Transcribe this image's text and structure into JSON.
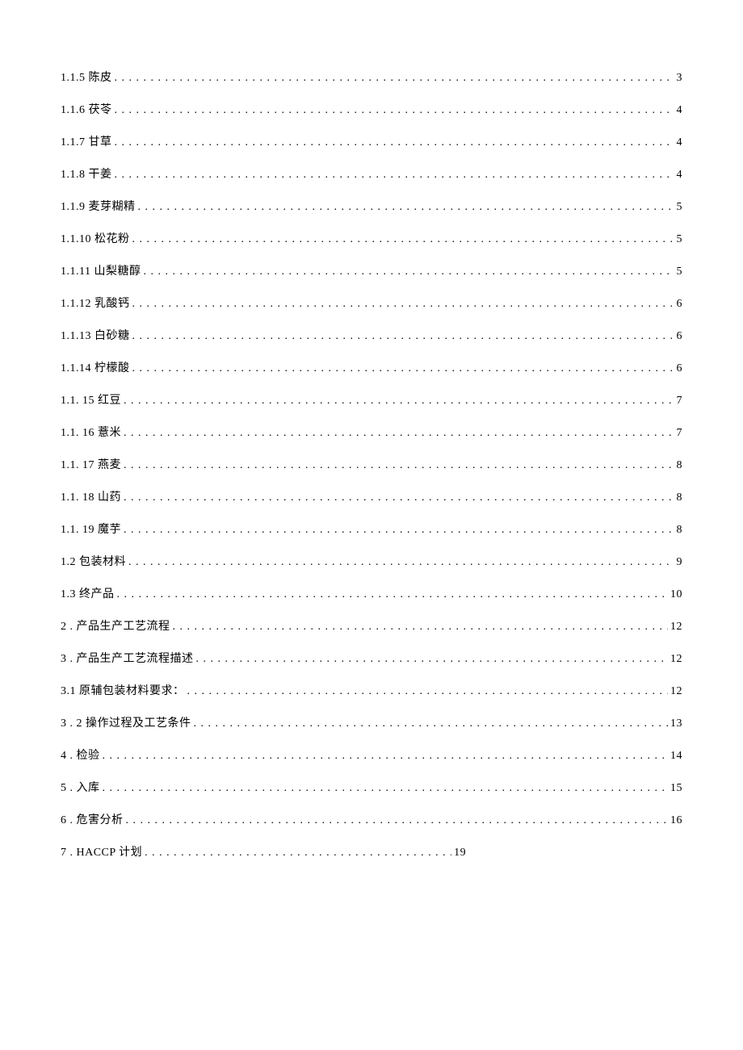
{
  "toc": [
    {
      "label": "1.1.5 陈皮 ",
      "page": "3",
      "short": false
    },
    {
      "label": "1.1.6 茯苓 ",
      "page": "4",
      "short": false
    },
    {
      "label": "1.1.7 甘草 ",
      "page": "4",
      "short": false
    },
    {
      "label": "1.1.8 干姜 ",
      "page": "4",
      "short": false
    },
    {
      "label": "1.1.9 麦芽糊精 ",
      "page": "5",
      "short": false
    },
    {
      "label": "1.1.10 松花粉 ",
      "page": "5",
      "short": false
    },
    {
      "label": "1.1.11 山梨糖醇 ",
      "page": "5",
      "short": false
    },
    {
      "label": "1.1.12 乳酸钙 ",
      "page": "6",
      "short": false
    },
    {
      "label": "1.1.13 白砂糖 ",
      "page": "6",
      "short": false
    },
    {
      "label": "1.1.14 柠檬酸 ",
      "page": "6",
      "short": false
    },
    {
      "label": "1.1.  15 红豆 ",
      "page": "7",
      "short": false
    },
    {
      "label": "1.1.  16 薏米 ",
      "page": "7",
      "short": false
    },
    {
      "label": "1.1.  17 燕麦 ",
      "page": "8",
      "short": false
    },
    {
      "label": "1.1.  18 山药 ",
      "page": "8",
      "short": false
    },
    {
      "label": "1.1.  19 魔芋 ",
      "page": "8",
      "short": false
    },
    {
      "label": "1.2  包装材料 ",
      "page": "9",
      "short": false
    },
    {
      "label": "1.3  终产品 ",
      "page": "10",
      "short": false
    },
    {
      "label": "2  . 产品生产工艺流程 ",
      "page": "12",
      "short": false
    },
    {
      "label": "3  . 产品生产工艺流程描述 ",
      "page": "12",
      "short": false
    },
    {
      "label": "3.1  原辅包装材料要求：",
      "page": "12",
      "short": false
    },
    {
      "label": "3  . 2 操作过程及工艺条件 ",
      "page": "13",
      "short": false
    },
    {
      "label": "4  . 检验 ",
      "page": "14",
      "short": false
    },
    {
      "label": "5  . 入库 ",
      "page": "15",
      "short": false
    },
    {
      "label": "6  . 危害分析 ",
      "page": "16",
      "short": false
    },
    {
      "label": "7  . HACCP 计划 ",
      "page": "19",
      "short": true
    }
  ]
}
